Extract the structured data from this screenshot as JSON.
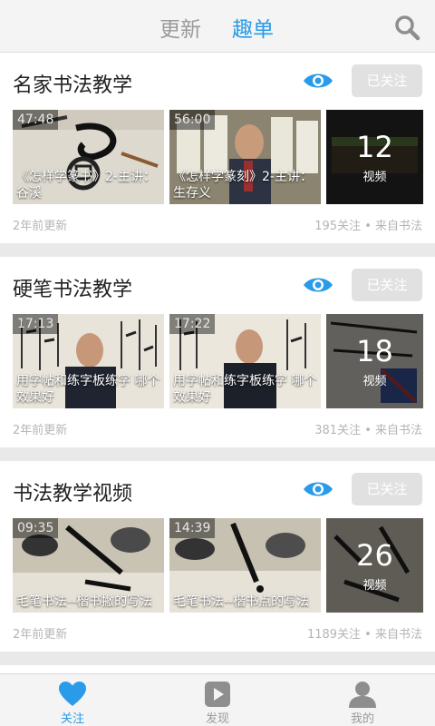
{
  "header": {
    "tabs": [
      {
        "label": "更新",
        "active": false
      },
      {
        "label": "趣单",
        "active": true
      }
    ],
    "search_icon": "search-icon",
    "accent_color": "#2a9be8"
  },
  "cards": [
    {
      "title": "名家书法教学",
      "follow_label": "已关注",
      "videos": [
        {
          "duration": "47:48",
          "caption": "《怎样学篆书》2-主讲：谷溪"
        },
        {
          "duration": "56:00",
          "caption": "《怎样学篆刻》2-主讲：生存义"
        }
      ],
      "more_count": "12",
      "more_label": "视频",
      "updated": "2年前更新",
      "stats": "195关注 • 来自书法"
    },
    {
      "title": "硬笔书法教学",
      "follow_label": "已关注",
      "videos": [
        {
          "duration": "17:13",
          "caption": "用字帖和练字板练字 哪个效果好"
        },
        {
          "duration": "17:22",
          "caption": "用字帖和练字板练字 哪个效果好"
        }
      ],
      "more_count": "18",
      "more_label": "视频",
      "updated": "2年前更新",
      "stats": "381关注 • 来自书法"
    },
    {
      "title": "书法教学视频",
      "follow_label": "已关注",
      "videos": [
        {
          "duration": "09:35",
          "caption": "毛笔书法--楷书撇的写法"
        },
        {
          "duration": "14:39",
          "caption": "毛笔书法--楷书点的写法"
        }
      ],
      "more_count": "26",
      "more_label": "视频",
      "updated": "2年前更新",
      "stats": "1189关注 • 来自书法"
    }
  ],
  "bottom_nav": [
    {
      "label": "关注",
      "icon": "heart-icon",
      "active": true
    },
    {
      "label": "发现",
      "icon": "play-icon",
      "active": false
    },
    {
      "label": "我的",
      "icon": "user-icon",
      "active": false
    }
  ]
}
